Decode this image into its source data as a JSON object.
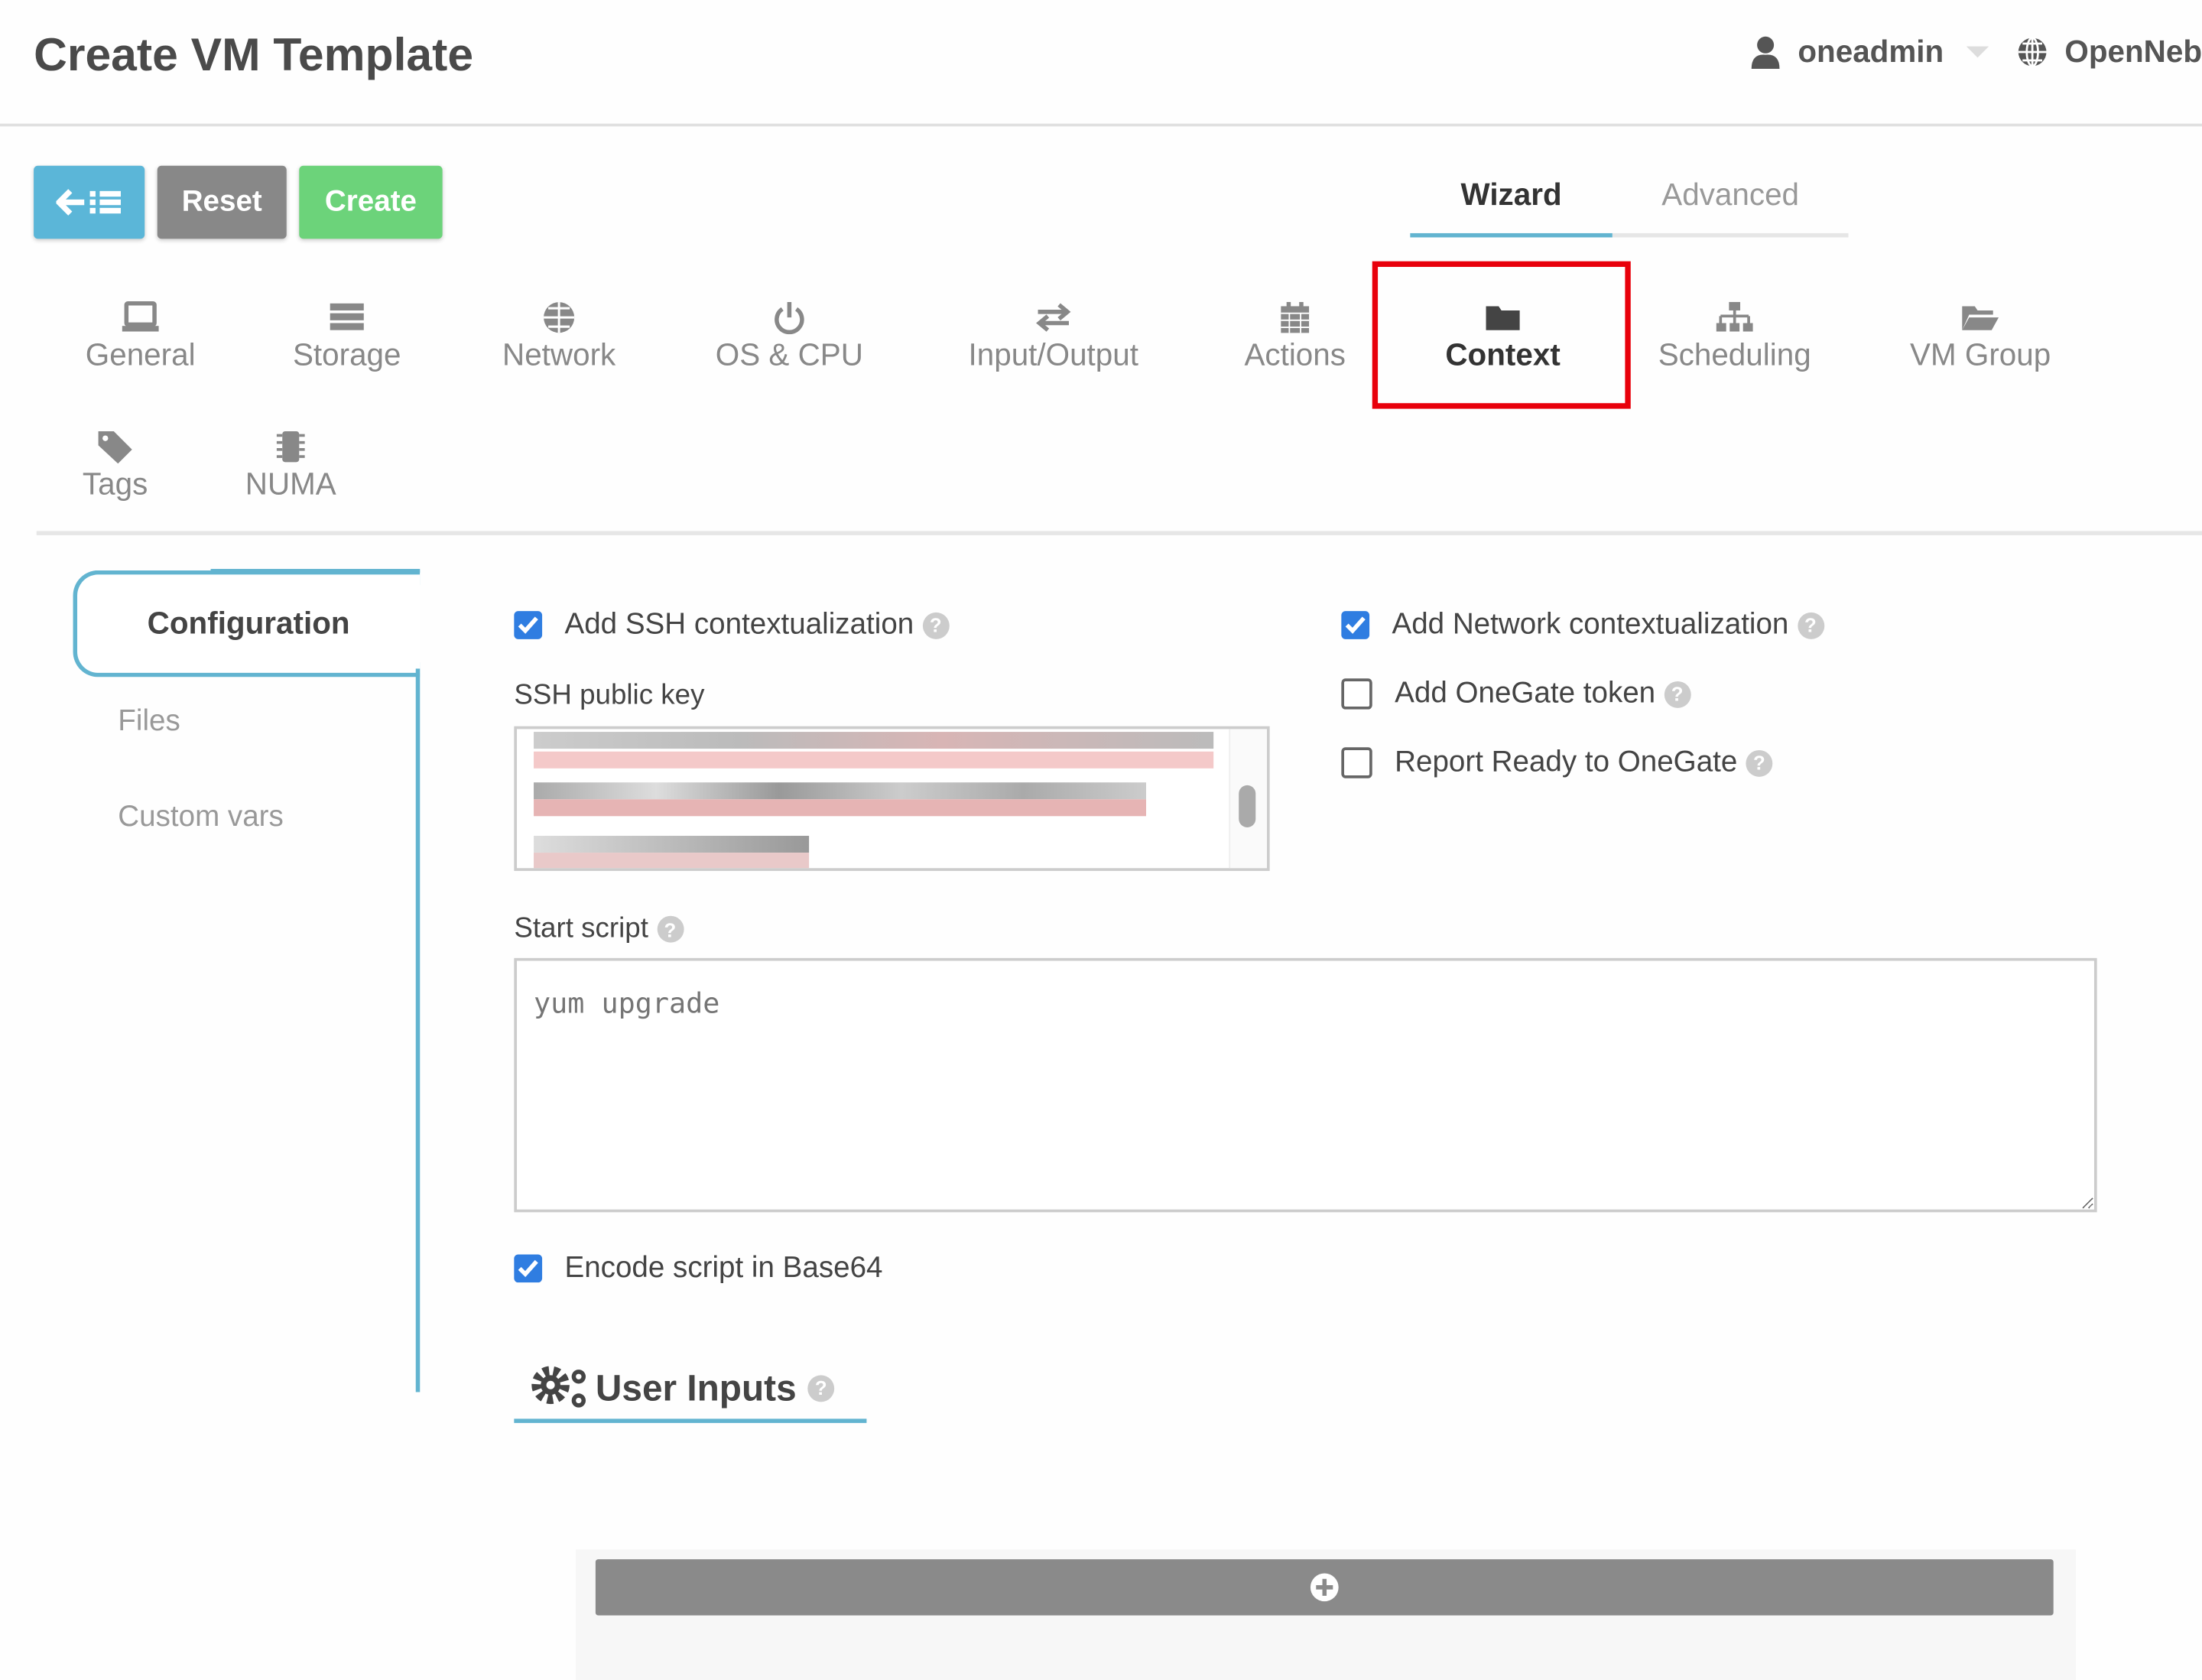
{
  "header": {
    "title": "Create VM Template",
    "user": "oneadmin",
    "zone": "OpenNeb"
  },
  "toolbar": {
    "back_icon": "arrow-left-list-icon",
    "reset_label": "Reset",
    "create_label": "Create"
  },
  "mode_tabs": [
    {
      "label": "Wizard",
      "active": true
    },
    {
      "label": "Advanced",
      "active": false
    }
  ],
  "section_tabs": [
    {
      "label": "General",
      "icon": "laptop-icon"
    },
    {
      "label": "Storage",
      "icon": "database-icon"
    },
    {
      "label": "Network",
      "icon": "globe-icon"
    },
    {
      "label": "OS & CPU",
      "icon": "power-icon"
    },
    {
      "label": "Input/Output",
      "icon": "exchange-icon"
    },
    {
      "label": "Actions",
      "icon": "calendar-icon"
    },
    {
      "label": "Context",
      "icon": "folder-icon",
      "active": true
    },
    {
      "label": "Scheduling",
      "icon": "sitemap-icon"
    },
    {
      "label": "VM Group",
      "icon": "folder-open-icon"
    },
    {
      "label": "Tags",
      "icon": "tag-icon"
    },
    {
      "label": "NUMA",
      "icon": "chip-icon"
    }
  ],
  "side_tabs": [
    {
      "label": "Configuration",
      "active": true
    },
    {
      "label": "Files"
    },
    {
      "label": "Custom vars"
    }
  ],
  "config": {
    "ssh_ctx": {
      "label": "Add SSH contextualization",
      "checked": true
    },
    "net_ctx": {
      "label": "Add Network contextualization",
      "checked": true
    },
    "onegate_token": {
      "label": "Add OneGate token",
      "checked": false
    },
    "report_ready": {
      "label": "Report Ready to OneGate",
      "checked": false
    },
    "ssh_key_label": "SSH public key",
    "start_script_label": "Start script",
    "start_script_placeholder": "yum upgrade",
    "encode_base64": {
      "label": "Encode script in Base64",
      "checked": true
    },
    "user_inputs_title": "User Inputs"
  },
  "colors": {
    "accent": "#62b4d0",
    "create": "#6cd37a",
    "highlight": "#e8000b",
    "checkbox": "#2f7de1"
  }
}
